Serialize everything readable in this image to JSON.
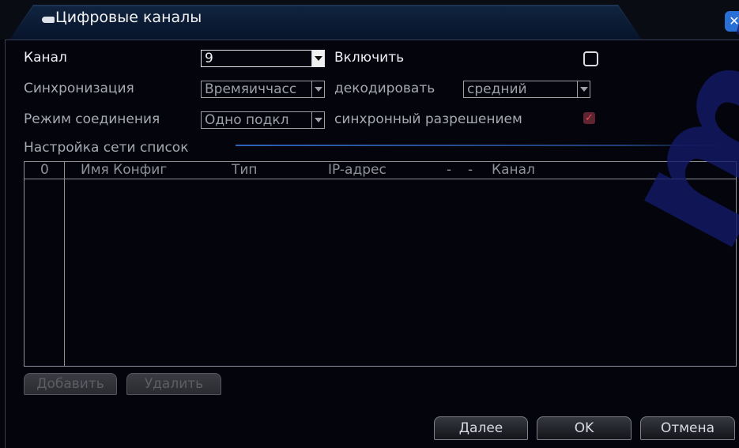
{
  "window": {
    "title": "Цифровые каналы",
    "close_glyph": "✕"
  },
  "form": {
    "channel_label": "Канал",
    "channel_value": "9",
    "enable_label": "Включить",
    "enable_checked": false,
    "sync_label": "Синхронизация",
    "sync_value": "Времяиччасс",
    "decode_label": "декодировать",
    "decode_value": "средний",
    "conn_mode_label": "Режим соединения",
    "conn_mode_value": "Одно подкл",
    "sync_res_label": "синхронный разрешением",
    "sync_res_checked": true,
    "sync_res_glyph": "✓"
  },
  "section": {
    "title": "Настройка сети список"
  },
  "table": {
    "columns": [
      "0",
      "Имя Конфиг",
      "Тип",
      "IP-адрес",
      "-",
      "-",
      "Канал"
    ],
    "rows": []
  },
  "buttons": {
    "add": "Добавить",
    "delete": "Удалить",
    "next": "Далее",
    "ok": "OK",
    "cancel": "Отмена"
  },
  "colors": {
    "background": "#03040c",
    "title_tab": "#0c1a33",
    "accent_line": "#2f62b8",
    "close_button": "#2a6fd6",
    "check_mark": "#e05151"
  },
  "icons": [
    "camera-icon",
    "close-icon",
    "dropdown-arrow-icon",
    "checkbox-icon"
  ]
}
